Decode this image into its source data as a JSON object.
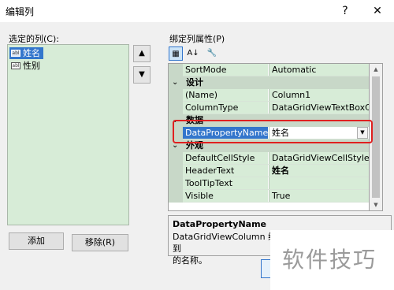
{
  "window": {
    "title": "编辑列",
    "help_label": "?",
    "close_label": "✕"
  },
  "left": {
    "selected_columns_label": "选定的列(C):",
    "columns": [
      {
        "label": "姓名",
        "icon": "abl"
      },
      {
        "label": "性别",
        "icon": "abl"
      }
    ],
    "move_up_label": "▲",
    "move_down_label": "▼",
    "add_label": "添加",
    "remove_label": "移除(R)"
  },
  "properties": {
    "header_label": "绑定列属性(P)",
    "toolbar": {
      "categorized_icon": "▦",
      "alphabetical_icon": "A↓",
      "pages_icon": "🔧"
    },
    "rows": [
      {
        "kind": "prop",
        "name": "SortMode",
        "value": "Automatic"
      },
      {
        "kind": "cat",
        "name": "设计",
        "toggle": "⌄"
      },
      {
        "kind": "prop",
        "name": "(Name)",
        "value": "Column1"
      },
      {
        "kind": "prop",
        "name": "ColumnType",
        "value": "DataGridViewTextBoxColu"
      },
      {
        "kind": "cat",
        "name": "数据",
        "toggle": "⌄"
      },
      {
        "kind": "prop",
        "name": "DataPropertyName",
        "value": "姓名"
      },
      {
        "kind": "cat",
        "name": "外观",
        "toggle": "⌄"
      },
      {
        "kind": "prop",
        "name": "DefaultCellStyle",
        "value": "DataGridViewCellStyle { }"
      },
      {
        "kind": "prop",
        "name": "HeaderText",
        "value": "姓名"
      },
      {
        "kind": "prop",
        "name": "ToolTipText",
        "value": ""
      },
      {
        "kind": "prop",
        "name": "Visible",
        "value": "True"
      }
    ],
    "description": {
      "title": "DataPropertyName",
      "text_line1": "DataGridViewColumn 绑定到",
      "text_line2": "的名称。"
    }
  },
  "watermark": "软件技巧",
  "colors": {
    "accent": "#3376cc",
    "grid_bg": "#d7ecd7",
    "highlight": "#e02020"
  }
}
